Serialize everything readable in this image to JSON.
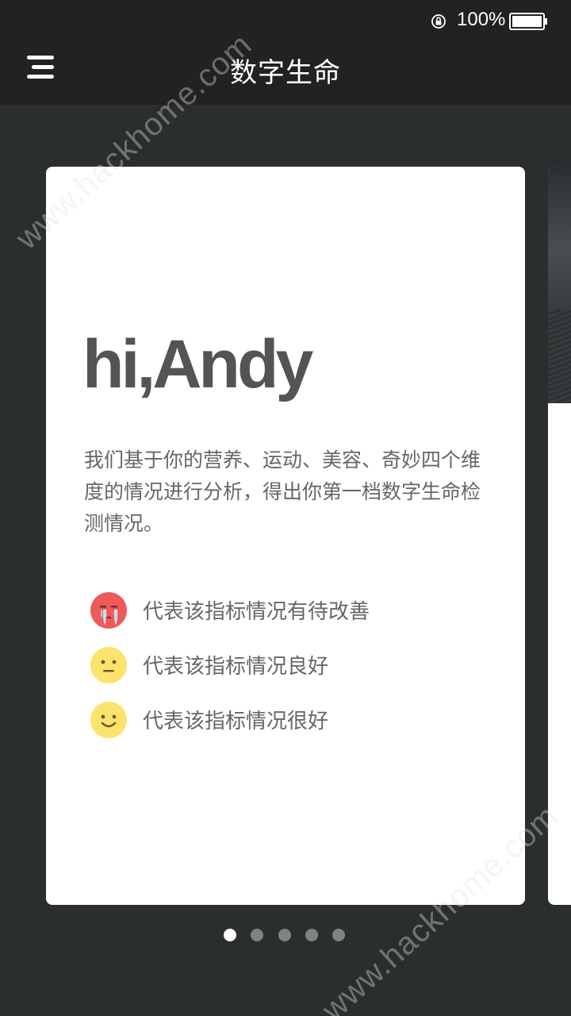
{
  "status_bar": {
    "lock_icon": "rotation-lock-icon",
    "battery_text": "100%",
    "battery_icon": "battery-full-icon"
  },
  "header": {
    "menu_icon": "menu-icon",
    "title": "数字生命"
  },
  "card": {
    "greeting": "hi,Andy",
    "intro": "我们基于你的营养、运动、美容、奇妙四个维度的情况进行分析，得出你第一档数字生命检测情况。",
    "legend": [
      {
        "icon": "crying-face-icon",
        "label": "代表该指标情况有待改善",
        "color": "#ee5a5a"
      },
      {
        "icon": "neutral-face-icon",
        "label": "代表该指标情况良好",
        "color": "#fbe36e"
      },
      {
        "icon": "smiling-face-icon",
        "label": "代表该指标情况很好",
        "color": "#fbe36e"
      }
    ]
  },
  "pager": {
    "total": 5,
    "active_index": 0
  },
  "watermark": {
    "text": "www.hackhome.com"
  },
  "colors": {
    "background": "#2a2e2f",
    "bar": "#222222",
    "card": "#ffffff",
    "text_primary": "#545454",
    "text_secondary": "#666666"
  }
}
